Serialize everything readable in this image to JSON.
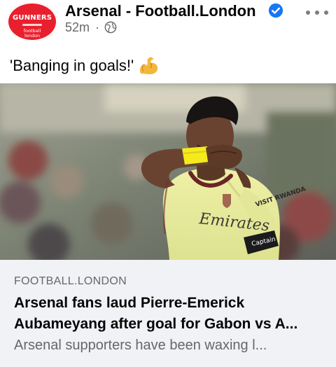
{
  "post": {
    "page_name": "Arsenal - Football.London",
    "verified": true,
    "timestamp": "52m",
    "separator": "·",
    "audience_icon": "globe-icon",
    "more_icon": "more-options-icon",
    "avatar": {
      "badge_text": "GUNNERS",
      "sub_text_1": "football",
      "sub_text_2": "london"
    },
    "caption": "'Banging in goals!'",
    "caption_emoji": "flexed-biceps-emoji",
    "photo_icon": "footballer-photo",
    "shirt_text": {
      "sponsor": "VISIT RWANDA",
      "chest": "Emirates",
      "armband": "Captain"
    }
  },
  "link_preview": {
    "domain": "FOOTBALL.LONDON",
    "title": "Arsenal fans laud Pierre-Emerick Aubameyang after goal for Gabon vs A...",
    "description": "Arsenal supporters have been waxing l..."
  },
  "colors": {
    "brand_red": "#e8202e",
    "verified_blue": "#1877f2",
    "secondary_text": "#65676b",
    "card_background": "#f0f2f5",
    "shirt_yellow": "#e9ec9a"
  }
}
